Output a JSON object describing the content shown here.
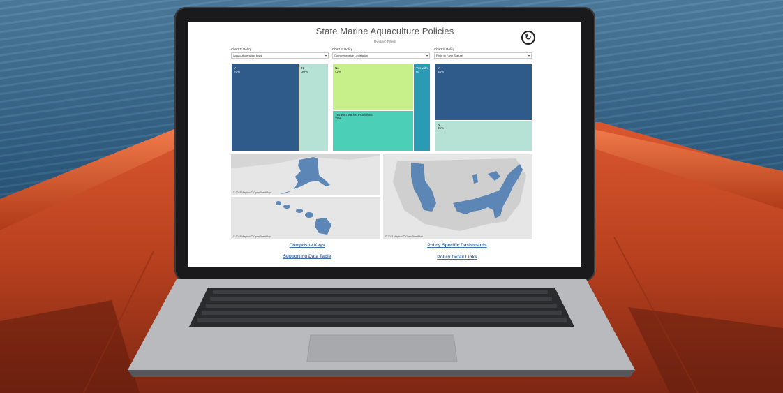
{
  "dashboard": {
    "title": "State Marine Aquaculture Policies",
    "subtitle": "Dynamic Filters",
    "reset_icon": "reset-icon",
    "filters": [
      {
        "label": "Chart 1: Policy",
        "value": "Aquaculture siting tests"
      },
      {
        "label": "Chart 2: Policy",
        "value": "Comprehensive Legislation"
      },
      {
        "label": "Chart 3: Policy",
        "value": "Right to Farm Statute"
      }
    ],
    "treemaps": [
      {
        "cells": [
          {
            "name": "Y",
            "pct": "70%",
            "color": "#2e5b8a"
          },
          {
            "name": "N",
            "pct": "30%",
            "color": "#b5e2d5"
          }
        ]
      },
      {
        "cells": [
          {
            "name": "No",
            "pct": "42%",
            "color": "#c7ef8a"
          },
          {
            "name": "Yes with Marine Provisions",
            "pct": "39%",
            "color": "#4ccfb7"
          },
          {
            "name": "Yes with no",
            "pct": "",
            "color": "#2b9ab4"
          }
        ]
      },
      {
        "cells": [
          {
            "name": "Y",
            "pct": "65%",
            "color": "#2e5b8a"
          },
          {
            "name": "N",
            "pct": "35%",
            "color": "#b5e2d5"
          }
        ]
      }
    ],
    "maps": {
      "attribution": "© 2023 Mapbox © OpenStreetMap",
      "highlight_color": "#5b86b6"
    },
    "links": [
      {
        "label": "Composite Keys"
      },
      {
        "label": "Policy Specific Dashboards"
      },
      {
        "label": "Supporting Data Table"
      },
      {
        "label": "Policy Detail Links"
      }
    ]
  }
}
